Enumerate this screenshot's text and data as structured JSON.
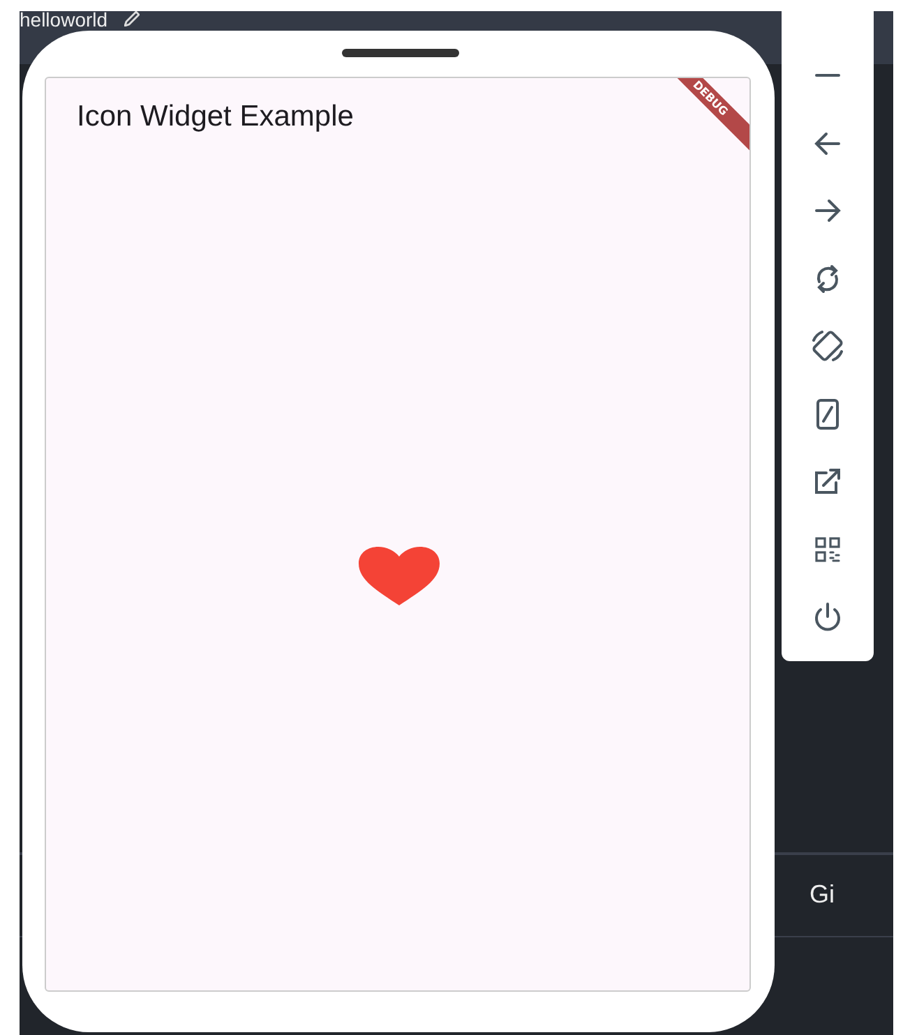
{
  "ide": {
    "project_title": "helloworld",
    "tab": "Gi"
  },
  "app": {
    "title": "Icon Widget Example",
    "debug_banner": "DEBUG"
  },
  "toolbar": {
    "buttons": [
      {
        "kind": "minimize"
      },
      {
        "kind": "back"
      },
      {
        "kind": "forward"
      },
      {
        "kind": "refresh"
      },
      {
        "kind": "rotate"
      },
      {
        "kind": "resize"
      },
      {
        "kind": "external"
      },
      {
        "kind": "qr"
      },
      {
        "kind": "power"
      }
    ]
  }
}
